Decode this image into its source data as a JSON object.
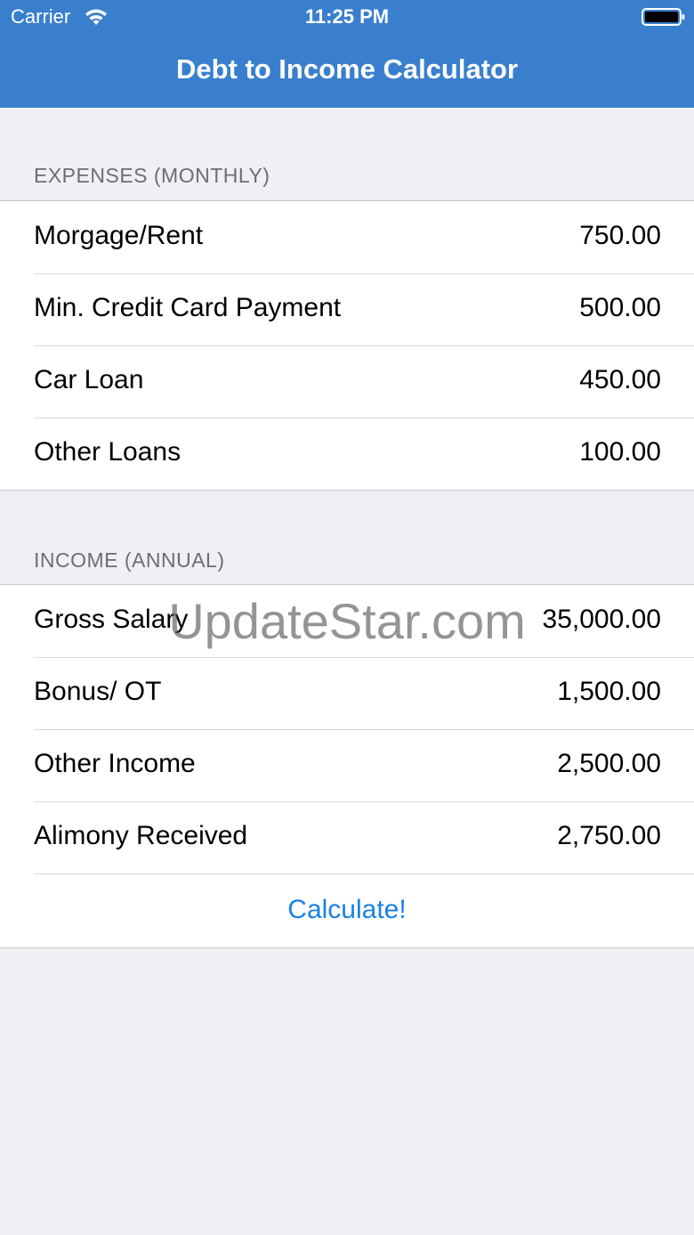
{
  "status_bar": {
    "carrier": "Carrier",
    "time": "11:25 PM",
    "wifi_icon": "wifi-icon",
    "battery_icon": "battery-icon"
  },
  "nav": {
    "title": "Debt to Income Calculator",
    "background_color": "#3a7fcd"
  },
  "expenses": {
    "header": "EXPENSES (MONTHLY)",
    "rows": [
      {
        "label": "Morgage/Rent",
        "value": "750.00"
      },
      {
        "label": "Min. Credit Card Payment",
        "value": "500.00"
      },
      {
        "label": "Car Loan",
        "value": "450.00"
      },
      {
        "label": "Other Loans",
        "value": "100.00"
      }
    ]
  },
  "income": {
    "header": "INCOME (ANNUAL)",
    "rows": [
      {
        "label": "Gross Salary",
        "value": "35,000.00"
      },
      {
        "label": "Bonus/ OT",
        "value": "1,500.00"
      },
      {
        "label": "Other Income",
        "value": "2,500.00"
      },
      {
        "label": "Alimony Received",
        "value": "2,750.00"
      }
    ]
  },
  "calculate_label": "Calculate!",
  "accent_color": "#1a82e2",
  "watermark": "UpdateStar.com"
}
